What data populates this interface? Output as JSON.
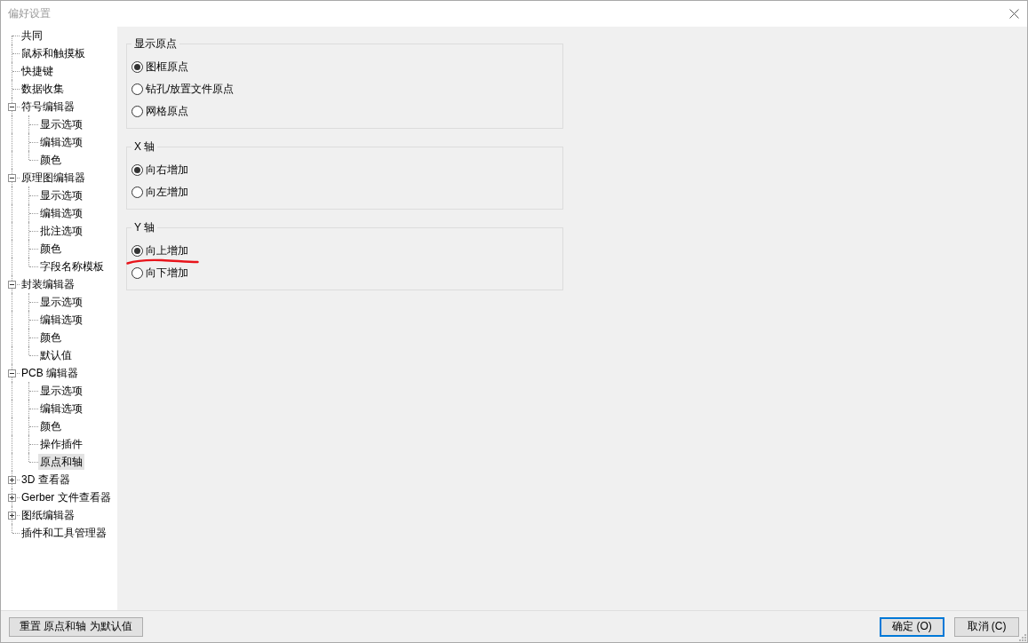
{
  "window": {
    "title": "偏好设置"
  },
  "tree": [
    {
      "label": "共同",
      "kind": "leaf",
      "selected": false
    },
    {
      "label": "鼠标和触摸板",
      "kind": "leaf",
      "selected": false
    },
    {
      "label": "快捷键",
      "kind": "leaf",
      "selected": false
    },
    {
      "label": "数据收集",
      "kind": "leaf",
      "selected": false
    },
    {
      "label": "符号编辑器",
      "kind": "folder",
      "expanded": true,
      "selected": false,
      "children": [
        {
          "label": "显示选项",
          "selected": false
        },
        {
          "label": "编辑选项",
          "selected": false
        },
        {
          "label": "颜色",
          "selected": false
        }
      ]
    },
    {
      "label": "原理图编辑器",
      "kind": "folder",
      "expanded": true,
      "selected": false,
      "children": [
        {
          "label": "显示选项",
          "selected": false
        },
        {
          "label": "编辑选项",
          "selected": false
        },
        {
          "label": "批注选项",
          "selected": false
        },
        {
          "label": "颜色",
          "selected": false
        },
        {
          "label": "字段名称模板",
          "selected": false
        }
      ]
    },
    {
      "label": "封装编辑器",
      "kind": "folder",
      "expanded": true,
      "selected": false,
      "children": [
        {
          "label": "显示选项",
          "selected": false
        },
        {
          "label": "编辑选项",
          "selected": false
        },
        {
          "label": "颜色",
          "selected": false
        },
        {
          "label": "默认值",
          "selected": false
        }
      ]
    },
    {
      "label": "PCB 编辑器",
      "kind": "folder",
      "expanded": true,
      "selected": false,
      "children": [
        {
          "label": "显示选项",
          "selected": false
        },
        {
          "label": "编辑选项",
          "selected": false
        },
        {
          "label": "颜色",
          "selected": false
        },
        {
          "label": "操作插件",
          "selected": false
        },
        {
          "label": "原点和轴",
          "selected": true
        }
      ]
    },
    {
      "label": "3D 查看器",
      "kind": "folder",
      "expanded": false,
      "selected": false
    },
    {
      "label": "Gerber 文件查看器",
      "kind": "folder",
      "expanded": false,
      "selected": false
    },
    {
      "label": "图纸编辑器",
      "kind": "folder",
      "expanded": false,
      "selected": false
    },
    {
      "label": "插件和工具管理器",
      "kind": "leaf",
      "selected": false
    }
  ],
  "groups": [
    {
      "title": "显示原点",
      "options": [
        {
          "label": "图框原点",
          "selected": true,
          "underlined": false
        },
        {
          "label": "钻孔/放置文件原点",
          "selected": false,
          "underlined": false
        },
        {
          "label": "网格原点",
          "selected": false,
          "underlined": false
        }
      ]
    },
    {
      "title": "X 轴",
      "options": [
        {
          "label": "向右增加",
          "selected": true,
          "underlined": false
        },
        {
          "label": "向左增加",
          "selected": false,
          "underlined": false
        }
      ]
    },
    {
      "title": "Y 轴",
      "options": [
        {
          "label": "向上增加",
          "selected": true,
          "underlined": true
        },
        {
          "label": "向下增加",
          "selected": false,
          "underlined": false
        }
      ]
    }
  ],
  "footer": {
    "reset_button": "重置 原点和轴 为默认值",
    "dialog_buttons": [
      {
        "label": "确定 (O)",
        "focused": true
      },
      {
        "label": "取消 (C)",
        "focused": false
      }
    ]
  }
}
